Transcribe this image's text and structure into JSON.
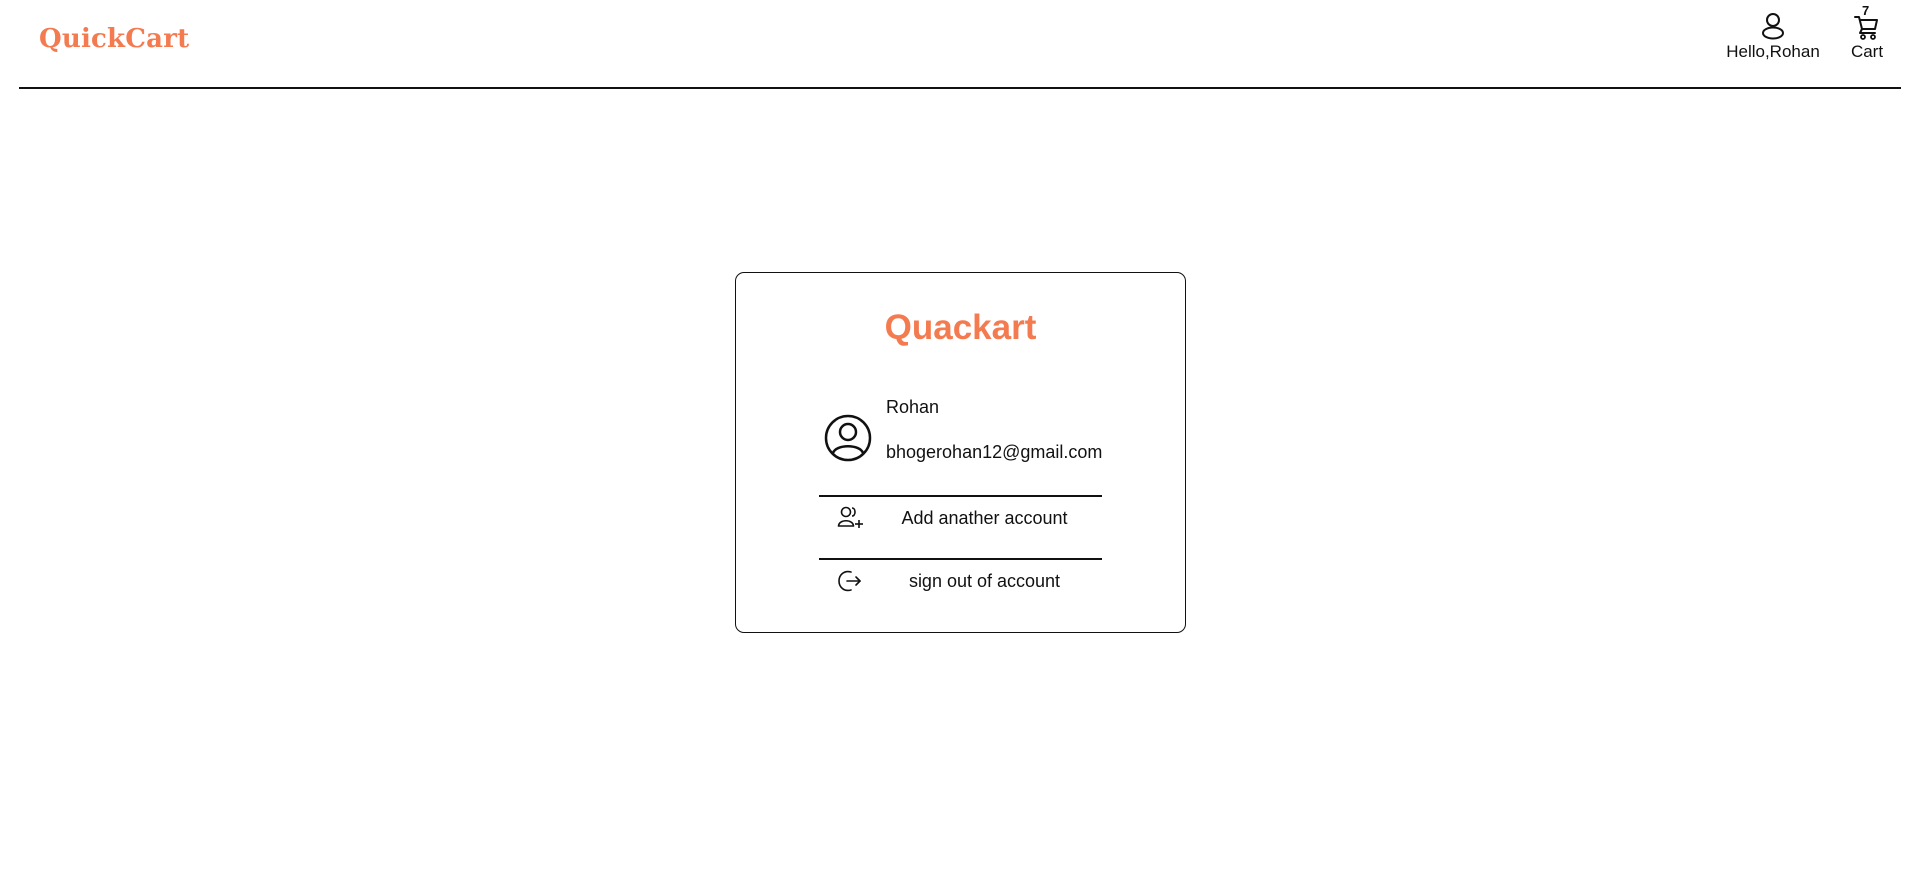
{
  "header": {
    "brand": "QuickCart",
    "greeting": "Hello,Rohan",
    "cart_label": "Cart",
    "cart_count": "7"
  },
  "card": {
    "title": "Quackart",
    "user_name": "Rohan",
    "user_email": "bhogerohan12@gmail.com",
    "add_account_label": "Add anather account",
    "sign_out_label": "sign out of account"
  },
  "colors": {
    "brand": "#f47b50",
    "text": "#111111",
    "border": "#111111"
  },
  "icons": {
    "user": "user-icon",
    "cart": "cart-icon",
    "profile": "user-circle-icon",
    "add_account": "user-plus-icon",
    "sign_out": "sign-out-icon"
  }
}
